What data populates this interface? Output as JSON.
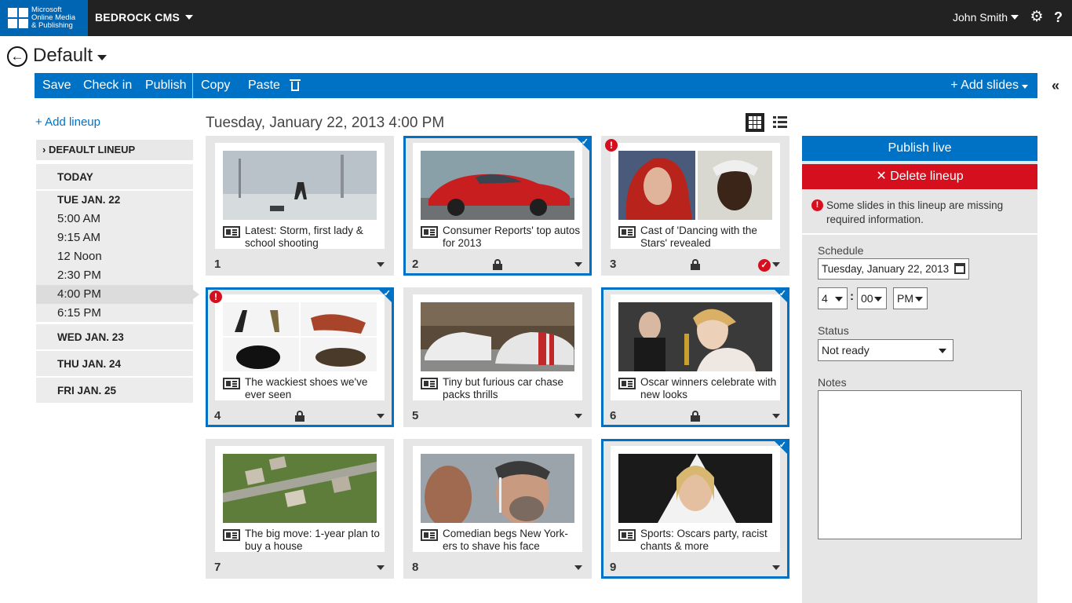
{
  "brand": {
    "line1": "Microsoft",
    "line2": "Online Media",
    "line3": "& Publishing"
  },
  "app_name": "BEDROCK CMS",
  "user": {
    "name": "John Smith"
  },
  "page": {
    "title": "Default"
  },
  "toolbar": {
    "save": "Save",
    "check_in": "Check in",
    "publish": "Publish",
    "copy": "Copy",
    "paste": "Paste",
    "add_slides": "+ Add slides"
  },
  "sidebar": {
    "add_lineup": "+ Add lineup",
    "lineup": "DEFAULT LINEUP",
    "today": "TODAY",
    "day1": {
      "label": "TUE JAN. 22",
      "times": [
        "5:00 AM",
        "9:15 AM",
        "12 Noon",
        "2:30 PM",
        "4:00 PM",
        "6:15 PM"
      ]
    },
    "day2": "WED JAN. 23",
    "day3": "THU JAN. 24",
    "day4": "FRI JAN. 25"
  },
  "main": {
    "date_heading": "Tuesday, January 22, 2013 4:00 PM",
    "slides": [
      {
        "num": "1",
        "caption": "Latest: Storm, first lady & school shooting"
      },
      {
        "num": "2",
        "caption": "Consumer Reports' top autos for 2013"
      },
      {
        "num": "3",
        "caption": "Cast of 'Dancing with the Stars' revealed"
      },
      {
        "num": "4",
        "caption": "The wackiest shoes we've ever seen"
      },
      {
        "num": "5",
        "caption": "Tiny but furious car chase packs thrills"
      },
      {
        "num": "6",
        "caption": "Oscar winners celebrate with new looks"
      },
      {
        "num": "7",
        "caption": "The big move: 1-year plan to buy a house"
      },
      {
        "num": "8",
        "caption": "Comedian begs New York-ers to shave his face"
      },
      {
        "num": "9",
        "caption": "Sports: Oscars party, racist chants & more"
      }
    ]
  },
  "panel": {
    "publish_live": "Publish live",
    "delete_lineup": "✕ Delete lineup",
    "warning": "Some slides in this lineup are missing required information.",
    "schedule_label": "Schedule",
    "schedule_date": "Tuesday, January 22, 2013",
    "hour": "4",
    "minute": "00",
    "ampm": "PM",
    "status_label": "Status",
    "status_value": "Not ready",
    "notes_label": "Notes"
  },
  "colors": {
    "brand_blue": "#0066b3",
    "toolbar_blue": "#0072c6",
    "error_red": "#d50f1e",
    "topbar": "#222222"
  }
}
